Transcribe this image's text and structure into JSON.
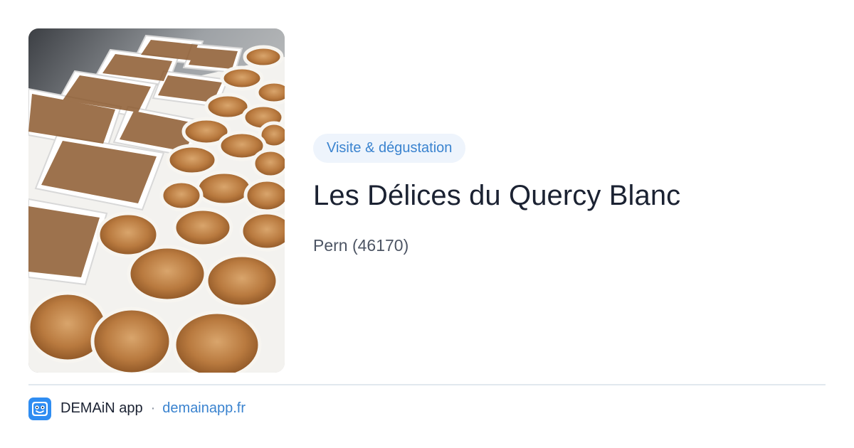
{
  "card": {
    "tag": "Visite & dégustation",
    "title": "Les Délices du Quercy Blanc",
    "location": "Pern (46170)"
  },
  "footer": {
    "app_name": "DEMAiN app",
    "separator": "·",
    "domain": "demainapp.fr"
  },
  "colors": {
    "tag_text": "#3a83cf",
    "tag_background": "#eef4fc",
    "title": "#1b2232",
    "location": "#4d5564",
    "link": "#3a83cf",
    "logo": "#2f8df2"
  }
}
